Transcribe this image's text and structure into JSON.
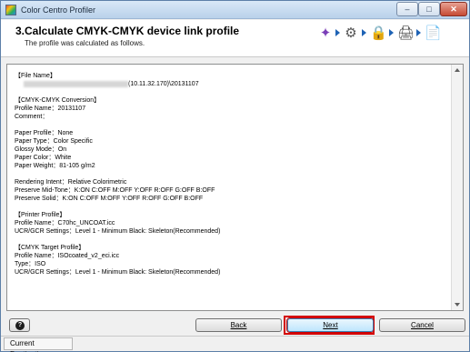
{
  "window": {
    "title": "Color Centro Profiler"
  },
  "window_controls": {
    "minimize": "–",
    "maximize": "□",
    "close": "✕"
  },
  "header": {
    "title": "3.Calculate CMYK-CMYK device link profile",
    "subtitle": "The profile was calculated as follows."
  },
  "wizard_steps": [
    {
      "icon": "wand-icon",
      "glyph": "✦"
    },
    {
      "icon": "gear-icon",
      "glyph": "⚙"
    },
    {
      "icon": "lock-folder-icon",
      "glyph": "🔒"
    },
    {
      "icon": "printer-user-icon",
      "glyph": "🖨"
    },
    {
      "icon": "document-export-icon",
      "glyph": "📄"
    }
  ],
  "content": {
    "file_name_heading": "【File Name】",
    "file_name_value": "(10.11.32.170)\\20131107",
    "conversion_heading": "【CMYK-CMYK Conversion】",
    "profile_name": "Profile Name：20131107",
    "comment": "Comment：",
    "paper_profile": "Paper Profile：None",
    "paper_type": "Paper Type：Color Specific",
    "glossy_mode": "Glossy Mode：On",
    "paper_color": "Paper Color：White",
    "paper_weight": "Paper Weight：81-105 g/m2",
    "rendering_intent": "Rendering Intent：Relative Colorimetric",
    "preserve_midtone": "Preserve Mid-Tone：K:ON C:OFF M:OFF Y:OFF R:OFF G:OFF B:OFF",
    "preserve_solid": "Preserve Solid：K:ON C:OFF M:OFF Y:OFF R:OFF G:OFF B:OFF",
    "printer_heading": "【Printer Profile】",
    "printer_profile_name": "Profile Name：C70hc_UNCOAT.icc",
    "printer_ucr": "UCR/GCR Settings：Level 1 - Minimum Black: Skeleton(Recommended)",
    "target_heading": "【CMYK Target Profile】",
    "target_profile_name": "Profile Name：ISOcoated_v2_eci.icc",
    "target_type": "Type：ISO",
    "target_ucr": "UCR/GCR Settings：Level 1 - Minimum Black: Skeleton(Recommended)"
  },
  "buttons": {
    "help": "?",
    "back": "Back",
    "next": "Next",
    "cancel": "Cancel"
  },
  "status_bar": {
    "current_destination": "Current Destination"
  }
}
